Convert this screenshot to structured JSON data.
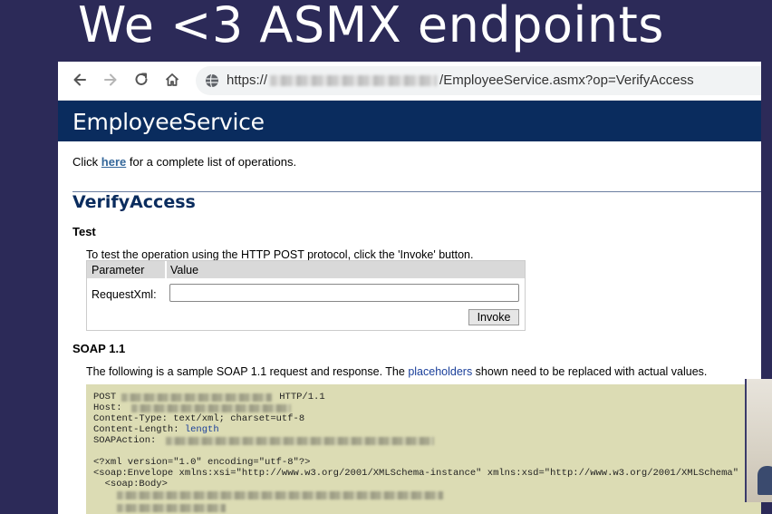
{
  "slide": {
    "title": "We <3 ASMX endpoints"
  },
  "browser": {
    "url_prefix": "https://",
    "url_suffix": "/EmployeeService.asmx?op=VerifyAccess",
    "back_icon": "arrow-left",
    "forward_icon": "arrow-right",
    "reload_icon": "reload",
    "home_icon": "home"
  },
  "service": {
    "title": "EmployeeService"
  },
  "intro": {
    "prefix": "Click ",
    "link": "here",
    "suffix": " for a complete list of operations."
  },
  "operation": {
    "title": "VerifyAccess"
  },
  "test": {
    "heading": "Test",
    "description": "To test the operation using the HTTP POST protocol, click the 'Invoke' button.",
    "col_parameter": "Parameter",
    "col_value": "Value",
    "param_label": "RequestXml:",
    "param_value": "",
    "invoke_label": "Invoke"
  },
  "soap": {
    "heading": "SOAP 1.1",
    "desc_prefix": "The following is a sample SOAP 1.1 request and response. The ",
    "desc_link": "placeholders",
    "desc_suffix": " shown need to be replaced with actual values.",
    "lines": {
      "post": "POST",
      "post_proto": "HTTP/1.1",
      "host": "Host:",
      "content_type": "Content-Type: text/xml; charset=utf-8",
      "content_length": "Content-Length: ",
      "length_value": "length",
      "soap_action": "SOAPAction: ",
      "xml_decl": "<?xml version=\"1.0\" encoding=\"utf-8\"?>",
      "envelope": "<soap:Envelope xmlns:xsi=\"http://www.w3.org/2001/XMLSchema-instance\" xmlns:xsd=\"http://www.w3.org/2001/XMLSchema\"",
      "body": "  <soap:Body>"
    }
  },
  "colors": {
    "slide_bg": "#2c2a58",
    "header_blue": "#0a2c5e",
    "code_bg": "#dcdcb4",
    "link": "#336699"
  }
}
